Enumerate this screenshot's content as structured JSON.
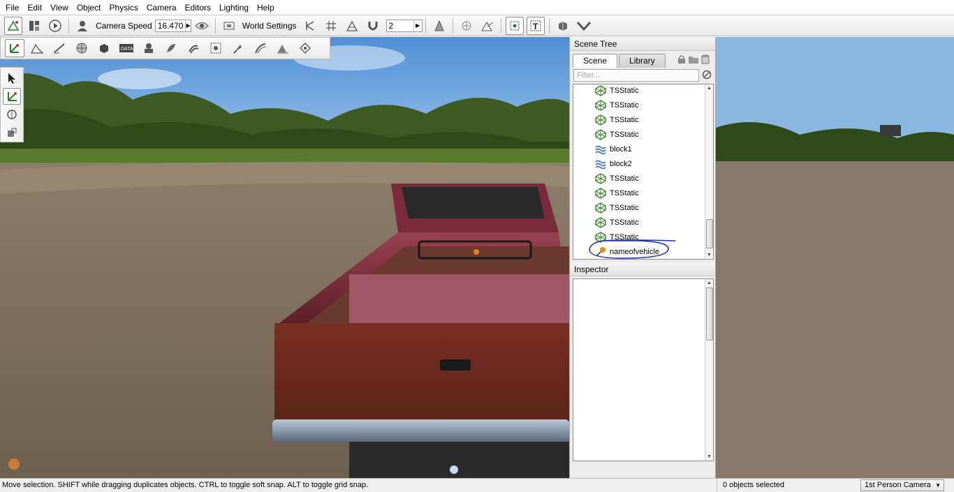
{
  "menu": [
    "File",
    "Edit",
    "View",
    "Object",
    "Physics",
    "Camera",
    "Editors",
    "Lighting",
    "Help"
  ],
  "toolbar": {
    "camera_speed_label": "Camera Speed",
    "camera_speed_value": "16.470",
    "world_settings_label": "World Settings",
    "snap_value": "2"
  },
  "scene_tree": {
    "title": "Scene Tree",
    "tabs": [
      "Scene",
      "Library"
    ],
    "active_tab": "Scene",
    "filter_placeholder": "Filter...",
    "items": [
      {
        "label": "TSStatic",
        "icon": "tsstatic-icon"
      },
      {
        "label": "TSStatic",
        "icon": "tsstatic-icon"
      },
      {
        "label": "TSStatic",
        "icon": "tsstatic-icon"
      },
      {
        "label": "TSStatic",
        "icon": "tsstatic-icon"
      },
      {
        "label": "block1",
        "icon": "water-block-icon"
      },
      {
        "label": "block2",
        "icon": "water-block-icon"
      },
      {
        "label": "TSStatic",
        "icon": "tsstatic-icon"
      },
      {
        "label": "TSStatic",
        "icon": "tsstatic-icon"
      },
      {
        "label": "TSStatic",
        "icon": "tsstatic-icon"
      },
      {
        "label": "TSStatic",
        "icon": "tsstatic-icon"
      },
      {
        "label": "TSStatic",
        "icon": "tsstatic-icon"
      },
      {
        "label": "nameofvehicle",
        "icon": "vehicle-icon"
      }
    ],
    "annotated_item": "nameofvehicle"
  },
  "inspector": {
    "title": "Inspector"
  },
  "status": {
    "message": "Move selection.  SHIFT while dragging duplicates objects.  CTRL to toggle soft snap.  ALT to toggle grid snap.",
    "selection": "0 objects selected",
    "camera_mode": "1st Person Camera"
  },
  "colors": {
    "tsstatic_green": "#3a8a2c",
    "water_blue": "#3a6fc8",
    "annotation_blue": "#1a2fc8",
    "truck_red": "#8a3040"
  }
}
